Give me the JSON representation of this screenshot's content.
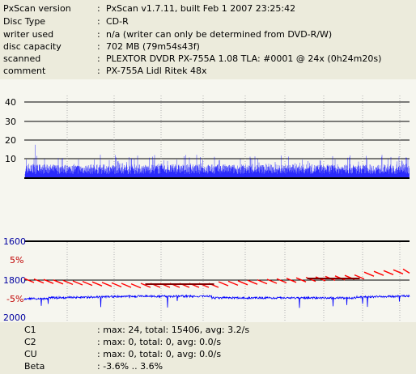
{
  "info": [
    {
      "key": "PxScan version",
      "value": "PxScan v1.7.11, built Feb  1 2007 23:25:42"
    },
    {
      "key": "Disc Type",
      "value": "CD-R"
    },
    {
      "key": "writer used",
      "value": "n/a (writer can only be determined from DVD-R/W)"
    },
    {
      "key": "disc capacity",
      "value": "702 MB (79m54s43f)"
    },
    {
      "key": "scanned",
      "value": "PLEXTOR DVDR  PX-755A 1.08 TLA: #0001 @ 24x (0h24m20s)"
    },
    {
      "key": "comment",
      "value": "PX-755A Lidl Ritek 48x"
    }
  ],
  "colon": ":",
  "graph_top": {
    "y_ticks": [
      "40",
      "30",
      "20",
      "10"
    ],
    "c1_color": "#0000ff"
  },
  "graph_bottom": {
    "left_labels": [
      {
        "text": "1600",
        "color": "#0000a0"
      },
      {
        "text": "5%",
        "color": "#c00000"
      },
      {
        "text": "1800",
        "color": "#0000a0"
      },
      {
        "text": "-5%",
        "color": "#c00000"
      },
      {
        "text": "2000",
        "color": "#0000a0"
      }
    ],
    "beta_color": "#ff0000",
    "jitter_color": "#0000ff"
  },
  "stats": [
    {
      "key": "C1",
      "value": ": max: 24, total: 15406, avg: 3.2/s"
    },
    {
      "key": "C2",
      "value": ": max: 0, total: 0, avg: 0.0/s"
    },
    {
      "key": "CU",
      "value": ": max: 0, total: 0, avg: 0.0/s"
    },
    {
      "key": "Beta",
      "value": ": -3.6% .. 3.6%"
    }
  ]
}
